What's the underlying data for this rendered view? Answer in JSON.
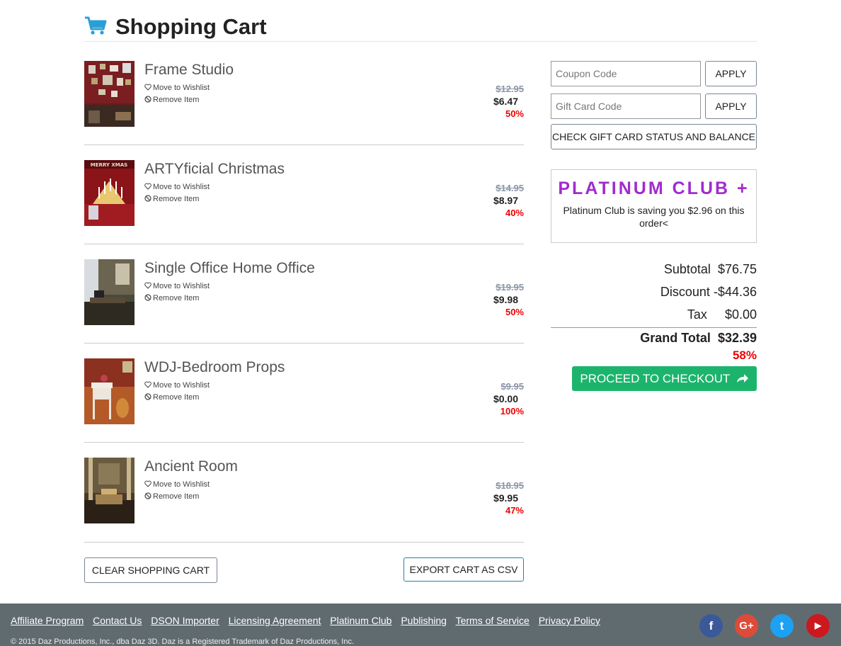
{
  "header": {
    "title": "Shopping Cart"
  },
  "items": [
    {
      "name": "Frame Studio",
      "wishlist": "Move to Wishlist",
      "remove": "Remove Item",
      "old_price": "$12.95",
      "price": "$6.47",
      "discount": "50%"
    },
    {
      "name": "ARTYficial Christmas",
      "wishlist": "Move to Wishlist",
      "remove": "Remove Item",
      "old_price": "$14.95",
      "price": "$8.97",
      "discount": "40%"
    },
    {
      "name": "Single Office Home Office",
      "wishlist": "Move to Wishlist",
      "remove": "Remove Item",
      "old_price": "$19.95",
      "price": "$9.98",
      "discount": "50%"
    },
    {
      "name": "WDJ-Bedroom Props",
      "wishlist": "Move to Wishlist",
      "remove": "Remove Item",
      "old_price": "$9.95",
      "price": "$0.00",
      "discount": "100%"
    },
    {
      "name": "Ancient Room",
      "wishlist": "Move to Wishlist",
      "remove": "Remove Item",
      "old_price": "$18.95",
      "price": "$9.95",
      "discount": "47%"
    }
  ],
  "cart_actions": {
    "clear": "CLEAR SHOPPING CART",
    "export": "EXPORT CART AS CSV"
  },
  "coupon": {
    "placeholder": "Coupon Code",
    "apply": "APPLY"
  },
  "gift": {
    "placeholder": "Gift Card Code",
    "apply": "APPLY",
    "check": "CHECK GIFT CARD STATUS AND BALANCE"
  },
  "club": {
    "logo": "PLATINUM CLUB +",
    "message": "Platinum Club is saving you $2.96 on this order<"
  },
  "totals": {
    "subtotal_label": "Subtotal",
    "subtotal": "$76.75",
    "discount_label": "Discount",
    "discount": "-$44.36",
    "tax_label": "Tax",
    "tax": "$0.00",
    "grand_label": "Grand Total",
    "grand": "$32.39",
    "saved_pct": "58%"
  },
  "checkout": {
    "label": "PROCEED TO CHECKOUT"
  },
  "footer": {
    "links": [
      "Affiliate Program",
      "Contact Us",
      "DSON Importer",
      "Licensing Agreement",
      "Platinum Club",
      "Publishing",
      "Terms of Service",
      "Privacy Policy"
    ],
    "copyright": "© 2015 Daz Productions, Inc., dba Daz 3D. Daz is a Registered Trademark of Daz Productions, Inc."
  },
  "social": [
    {
      "icon": "facebook-icon",
      "glyph": "f",
      "color": "#3b5998"
    },
    {
      "icon": "google-plus-icon",
      "glyph": "G+",
      "color": "#dd4b39"
    },
    {
      "icon": "twitter-icon",
      "glyph": "t",
      "color": "#1da1f2"
    },
    {
      "icon": "youtube-icon",
      "glyph": "▶",
      "color": "#cc181e"
    }
  ],
  "colors": {
    "accent": "#2a9fd6",
    "checkout": "#1cb46c",
    "discount": "#ee0000",
    "club": "#a12bcf",
    "footer": "#606b70"
  }
}
